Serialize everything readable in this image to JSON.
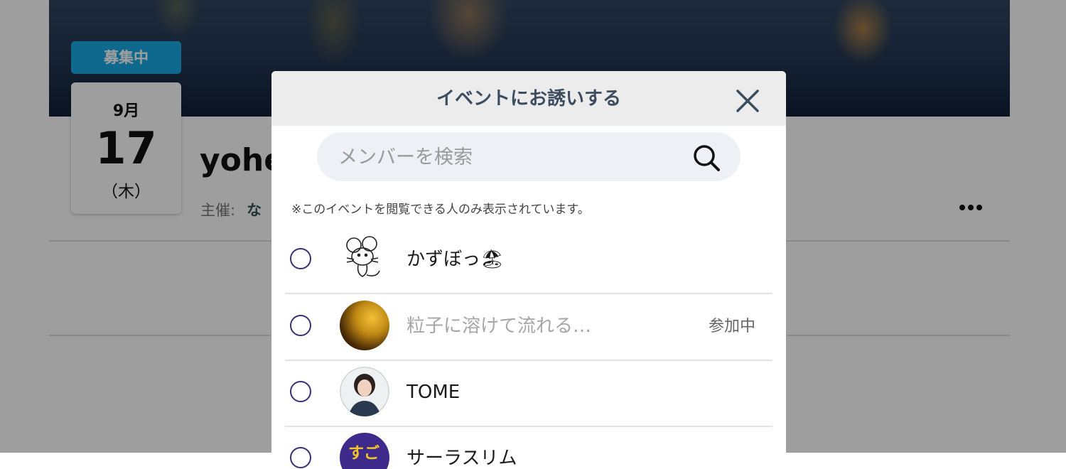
{
  "event": {
    "status_badge": "募集中",
    "month": "9月",
    "day": "17",
    "weekday": "（木）",
    "title": "yohe",
    "host_label": "主催:",
    "host_name": "な"
  },
  "modal": {
    "title": "イベントにお誘いする",
    "search_placeholder": "メンバーを検索",
    "notice": "※このイベントを閲覧できる人のみ表示されています。",
    "members": [
      {
        "name": "かずぼっ🏖",
        "status": "",
        "avatar": "mouse-sketch"
      },
      {
        "name": "粒子に溶けて流れる…",
        "status": "参加中",
        "avatar": "gold-abstract"
      },
      {
        "name": "TOME",
        "status": "",
        "avatar": "woman-portrait"
      },
      {
        "name": "サーラスリム",
        "status": "",
        "avatar": "purple-text"
      }
    ]
  },
  "colors": {
    "badge": "#19a9e6",
    "radio_border": "#3c2f78",
    "header_bg": "#ececec",
    "title_text": "#3c4d60"
  }
}
